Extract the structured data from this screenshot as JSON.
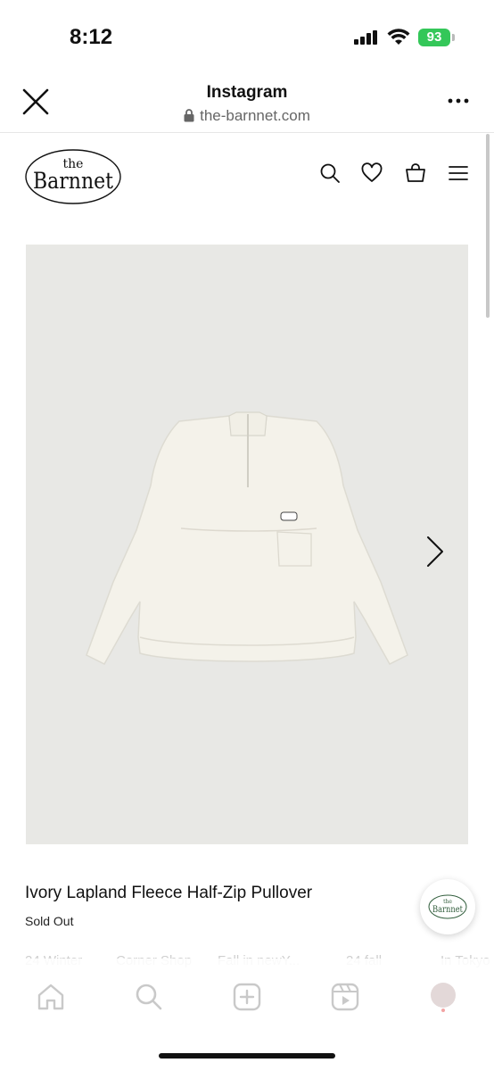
{
  "status_bar": {
    "time": "8:12",
    "battery": "93"
  },
  "browser": {
    "title": "Instagram",
    "url": "the-barnnet.com"
  },
  "site": {
    "logo_top": "the",
    "logo_main": "Barnnet"
  },
  "icons": {
    "search": "search-icon",
    "wishlist": "heart-icon",
    "cart": "bag-icon",
    "menu": "hamburger-menu-icon",
    "next": "chevron-right-icon",
    "close": "close-icon",
    "more": "more-icon"
  },
  "product": {
    "title": "Ivory Lapland Fleece Half-Zip Pullover",
    "status": "Sold Out"
  },
  "chat_badge": {
    "logo_top": "the",
    "logo_main": "Barnnet"
  },
  "ig_tabs": [
    "24 Winter",
    "Corner Shop",
    "Fall in newY...",
    "24 fall",
    "In Tokyo"
  ],
  "colors": {
    "battery": "#34c759",
    "image_bg": "#e8e8e5",
    "garment": "#f4f2ea"
  }
}
